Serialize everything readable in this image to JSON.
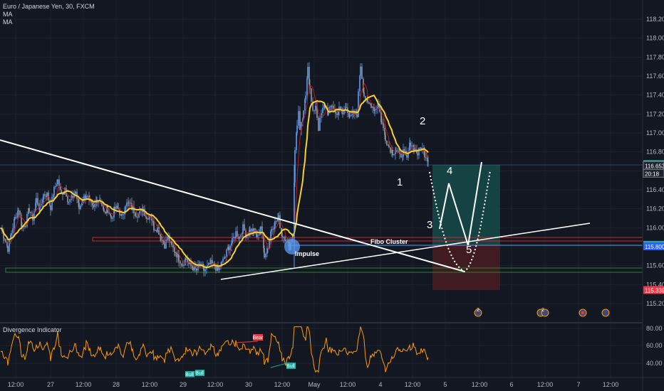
{
  "header": {
    "symbol_line": "Euro / Japanese Yen, 30, FXCM",
    "ma1": "MA",
    "ma2": "MA"
  },
  "indicator": {
    "label": "Divergence Indicator",
    "tags": [
      {
        "text": "Bear",
        "kind": "bear",
        "idx": 0
      },
      {
        "text": "Bull",
        "kind": "bull",
        "idx": 1
      },
      {
        "text": "Bull",
        "kind": "bull",
        "idx": 2
      },
      {
        "text": "Bull",
        "kind": "bull",
        "idx": 3
      }
    ],
    "y_ticks": [
      "80.00",
      "60.00",
      "40.00"
    ]
  },
  "annotations": {
    "wave1": "1",
    "wave2": "2",
    "wave3": "3",
    "wave4": "4",
    "wave5": "5",
    "impulse": "Impulse",
    "fibo": "Fibo Cluster"
  },
  "events": [
    {
      "text": "2"
    },
    {
      "text": "2"
    },
    {
      "text": "2"
    }
  ],
  "colors": {
    "background": "#131722",
    "candle_up": "#5b9cf6",
    "candle_down": "#9598a1",
    "ma_fast": "#c1121f",
    "ma_slow": "#f5d131",
    "rsi": "#ff9800",
    "price_tag": "#26a69a",
    "current_tag": "#2962ff",
    "sl_tag": "#f23645",
    "target_zone": "#164a48",
    "stop_zone": "#4a1c22"
  },
  "chart_data": {
    "type": "candlestick",
    "title": "Euro / Japanese Yen, 30, FXCM",
    "y_ticks": [
      "118.200",
      "118.000",
      "117.800",
      "117.600",
      "117.400",
      "117.200",
      "117.000",
      "116.800",
      "116.600",
      "116.400",
      "116.200",
      "116.000",
      "115.800",
      "115.600",
      "115.400",
      "115.200"
    ],
    "x_ticks": [
      "12:00",
      "27",
      "12:00",
      "28",
      "12:00",
      "29",
      "12:00",
      "30",
      "12:00",
      "May",
      "12:00",
      "4",
      "12:00",
      "5",
      "12:00",
      "6",
      "12:00",
      "7",
      "12:00"
    ],
    "ylim": [
      115.05,
      118.3
    ],
    "price_tags": [
      {
        "label": "116.668",
        "value": 116.668,
        "kind": "green"
      },
      {
        "label": "116.653",
        "value": 116.653,
        "kind": "white"
      },
      {
        "label": "20:18",
        "value": 116.57,
        "kind": "white"
      },
      {
        "label": "115.816",
        "value": 115.816,
        "kind": "green"
      },
      {
        "label": "115.800",
        "value": 115.8,
        "kind": "blue"
      },
      {
        "label": "115.339",
        "value": 115.339,
        "kind": "red"
      }
    ],
    "close_price_path": [
      [
        0,
        116.0
      ],
      [
        5,
        115.9
      ],
      [
        10,
        115.78
      ],
      [
        15,
        115.95
      ],
      [
        20,
        116.1
      ],
      [
        25,
        116.2
      ],
      [
        30,
        116.0
      ],
      [
        35,
        116.05
      ],
      [
        40,
        116.2
      ],
      [
        45,
        116.1
      ],
      [
        50,
        116.3
      ],
      [
        55,
        116.2
      ],
      [
        60,
        116.35
      ],
      [
        65,
        116.35
      ],
      [
        70,
        116.22
      ],
      [
        75,
        116.4
      ],
      [
        80,
        116.5
      ],
      [
        85,
        116.35
      ],
      [
        90,
        116.42
      ],
      [
        95,
        116.28
      ],
      [
        100,
        116.3
      ],
      [
        105,
        116.38
      ],
      [
        110,
        116.2
      ],
      [
        115,
        116.3
      ],
      [
        120,
        116.35
      ],
      [
        125,
        116.25
      ],
      [
        130,
        116.2
      ],
      [
        135,
        116.3
      ],
      [
        140,
        116.3
      ],
      [
        145,
        116.15
      ],
      [
        150,
        116.2
      ],
      [
        155,
        116.1
      ],
      [
        160,
        116.2
      ],
      [
        165,
        116.2
      ],
      [
        170,
        116.1
      ],
      [
        175,
        116.25
      ],
      [
        180,
        116.25
      ],
      [
        185,
        116.2
      ],
      [
        190,
        116.15
      ],
      [
        195,
        116.15
      ],
      [
        200,
        116.2
      ],
      [
        205,
        116.1
      ],
      [
        210,
        116.15
      ],
      [
        215,
        116.0
      ],
      [
        220,
        116.0
      ],
      [
        225,
        115.9
      ],
      [
        230,
        115.82
      ],
      [
        235,
        115.9
      ],
      [
        240,
        115.8
      ],
      [
        245,
        115.75
      ],
      [
        250,
        115.68
      ],
      [
        255,
        115.62
      ],
      [
        260,
        115.68
      ],
      [
        265,
        115.6
      ],
      [
        270,
        115.58
      ],
      [
        275,
        115.55
      ],
      [
        280,
        115.6
      ],
      [
        285,
        115.55
      ],
      [
        290,
        115.58
      ],
      [
        295,
        115.62
      ],
      [
        300,
        115.6
      ],
      [
        305,
        115.55
      ],
      [
        310,
        115.62
      ],
      [
        315,
        115.7
      ],
      [
        320,
        115.8
      ],
      [
        325,
        115.85
      ],
      [
        330,
        115.95
      ],
      [
        335,
        115.9
      ],
      [
        340,
        116.0
      ],
      [
        345,
        115.92
      ],
      [
        350,
        115.98
      ],
      [
        355,
        115.96
      ],
      [
        360,
        115.9
      ],
      [
        365,
        116.02
      ],
      [
        370,
        115.72
      ],
      [
        375,
        115.8
      ],
      [
        380,
        116.0
      ],
      [
        385,
        116.05
      ],
      [
        390,
        116.1
      ],
      [
        395,
        115.92
      ],
      [
        400,
        115.9
      ],
      [
        405,
        115.8
      ],
      [
        410,
        115.9
      ],
      [
        413,
        116.8
      ],
      [
        416,
        117.1
      ],
      [
        418,
        117.22
      ],
      [
        420,
        117.0
      ],
      [
        425,
        117.2
      ],
      [
        428,
        117.4
      ],
      [
        431,
        117.72
      ],
      [
        434,
        117.45
      ],
      [
        438,
        117.2
      ],
      [
        442,
        117.3
      ],
      [
        446,
        117.05
      ],
      [
        450,
        117.2
      ],
      [
        455,
        117.3
      ],
      [
        460,
        117.2
      ],
      [
        465,
        117.3
      ],
      [
        470,
        117.2
      ],
      [
        475,
        117.25
      ],
      [
        480,
        117.2
      ],
      [
        485,
        117.3
      ],
      [
        490,
        117.15
      ],
      [
        495,
        117.2
      ],
      [
        500,
        117.2
      ],
      [
        505,
        117.72
      ],
      [
        510,
        117.4
      ],
      [
        515,
        117.3
      ],
      [
        520,
        117.3
      ],
      [
        525,
        117.25
      ],
      [
        530,
        117.3
      ],
      [
        535,
        117.1
      ],
      [
        540,
        116.95
      ],
      [
        545,
        116.85
      ],
      [
        550,
        116.8
      ],
      [
        555,
        116.82
      ],
      [
        560,
        116.75
      ],
      [
        565,
        116.8
      ],
      [
        570,
        116.72
      ],
      [
        575,
        116.9
      ],
      [
        580,
        116.85
      ],
      [
        585,
        116.78
      ],
      [
        590,
        116.85
      ],
      [
        595,
        116.78
      ],
      [
        600,
        116.72
      ],
      [
        602,
        116.66
      ]
    ]
  }
}
